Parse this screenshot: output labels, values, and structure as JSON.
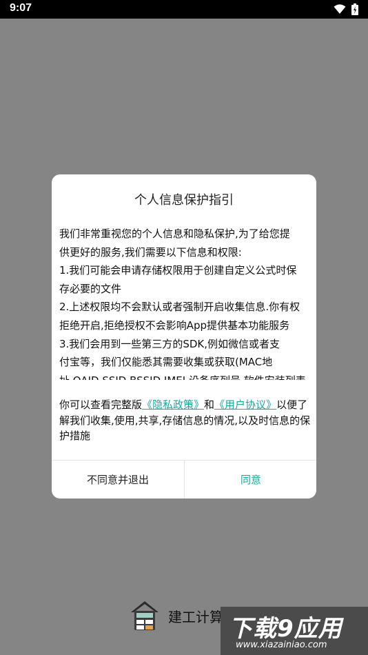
{
  "status_bar": {
    "time": "9:07"
  },
  "dialog": {
    "title": "个人信息保护指引",
    "body_lines": [
      "我们非常重视您的个人信息和隐私保护,为了给您提",
      "供更好的服务,我们需要以下信息和权限:",
      "1.我们可能会申请存储权限用于创建自定义公式时保",
      "存必要的文件",
      "2.上述权限均不会默认或者强制开启收集信息.你有权",
      "拒绝开启,拒绝授权不会影响App提供基本功能服务",
      "3.我们会用到一些第三方的SDK,例如微信或者支",
      "付宝等，我们仅能悉其需要收集或获取(MAC地",
      "址,OAID,SSID,BSSID,IMEI,设备序列号,软件安装列表"
    ],
    "footer_prefix": "你可以查看完整版",
    "privacy_link": "《隐私政策》",
    "and_text": "和",
    "agreement_link": "《用户协议》",
    "footer_suffix": "以便了解我们收集,使用,共享,存储信息的情况,以及时信息的保护措施",
    "cancel_label": "不同意并退出",
    "ok_label": "同意",
    "accent_color": "#1aa7a0"
  },
  "app": {
    "name": "建工计算"
  },
  "watermark": {
    "main": "下载9应用",
    "url": "www.xiazainiao.com"
  }
}
